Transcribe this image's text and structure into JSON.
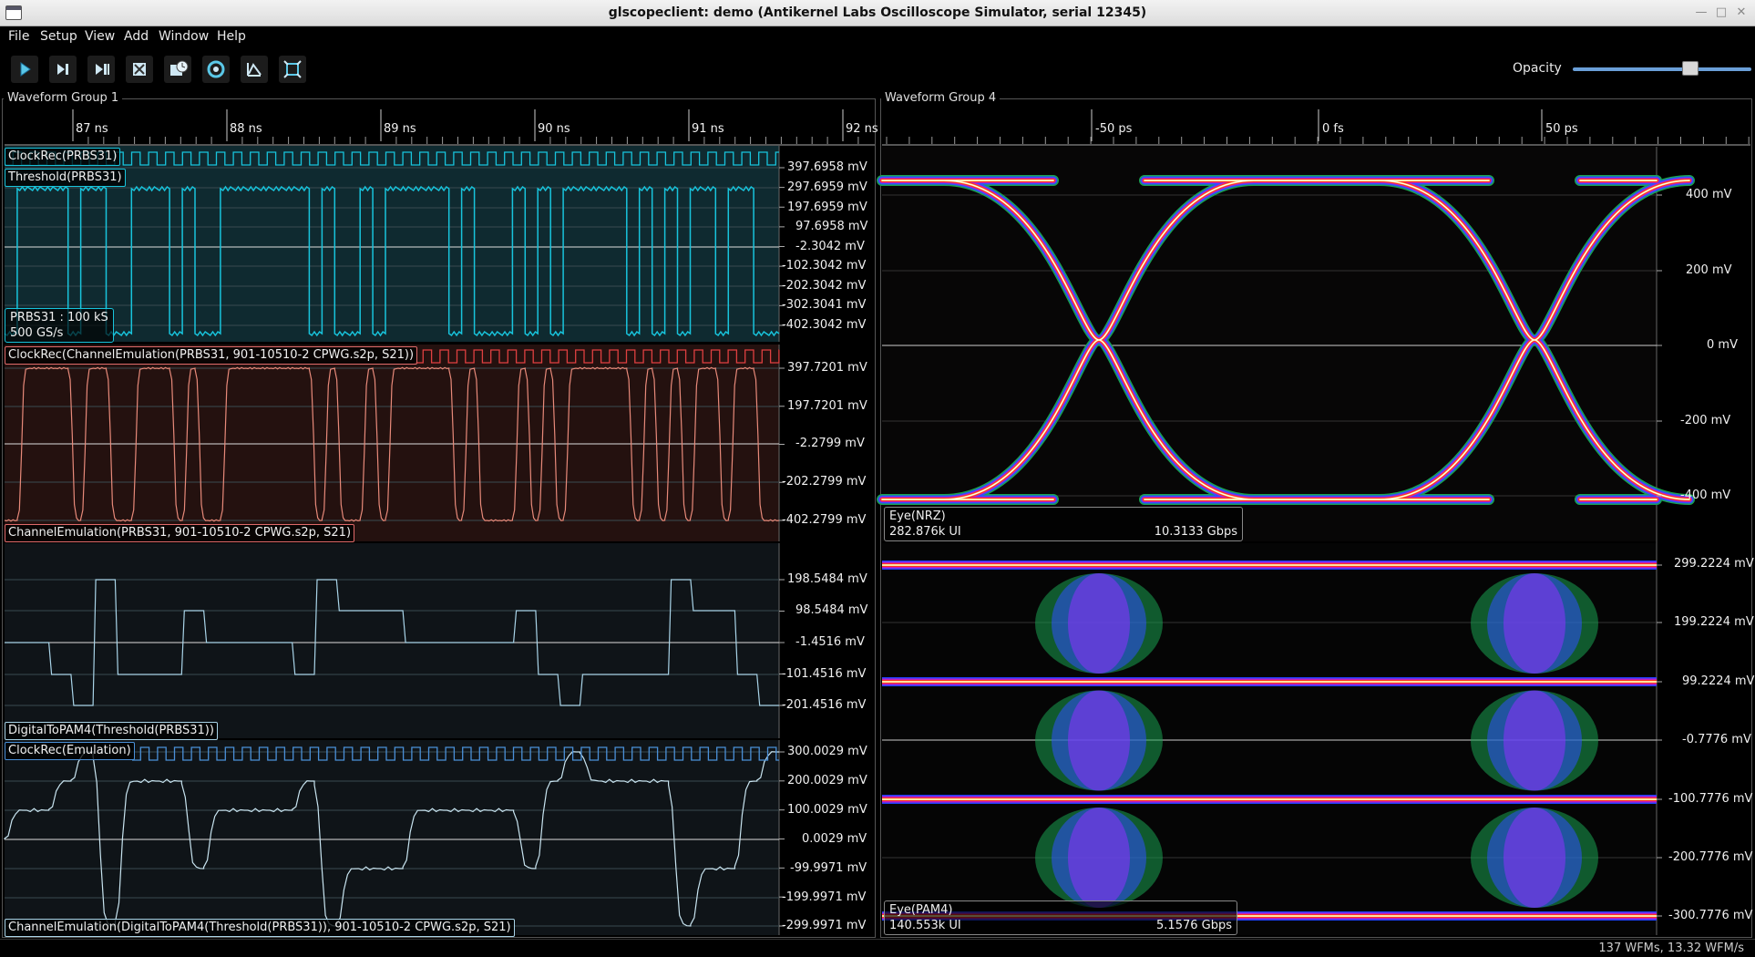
{
  "window": {
    "title": "glscopeclient: demo (Antikernel Labs Oscilloscope Simulator, serial 12345)"
  },
  "menu": [
    "File",
    "Setup",
    "View",
    "Add",
    "Window",
    "Help"
  ],
  "toolbar": {
    "buttons": [
      "start-icon",
      "single-shot-icon",
      "force-trigger-icon",
      "stop-icon",
      "history-icon",
      "refresh-icon",
      "fullscreen-icon",
      "clear-sweeps-icon"
    ],
    "opacity_label": "Opacity",
    "opacity_value": 0.55
  },
  "group1": {
    "title": "Waveform Group 1",
    "time_ticks": [
      "87 ns",
      "88 ns",
      "89 ns",
      "90 ns",
      "91 ns",
      "92 ns"
    ],
    "plots": [
      {
        "color": "#18c4dc",
        "labels": [
          "ClockRec(PRBS31)",
          "Threshold(PRBS31)"
        ],
        "info": [
          "PRBS31 : 100 kS",
          "500 GS/s"
        ],
        "y_ticks": [
          "397.6958 mV",
          "297.6959 mV",
          "197.6959 mV",
          "97.6958 mV",
          "-2.3042 mV",
          "-102.3042 mV",
          "-202.3042 mV",
          "-302.3041 mV",
          "-402.3042 mV"
        ]
      },
      {
        "color": "#e06a6a",
        "labels": [
          "ClockRec(ChannelEmulation(PRBS31, 901-10510-2 CPWG.s2p, S21))"
        ],
        "bottom_label": "ChannelEmulation(PRBS31, 901-10510-2 CPWG.s2p, S21)",
        "y_ticks": [
          "397.7201 mV",
          "197.7201 mV",
          "-2.2799 mV",
          "-202.2799 mV",
          "-402.2799 mV"
        ]
      },
      {
        "color": "#a9d4e8",
        "bottom_label": "DigitalToPAM4(Threshold(PRBS31))",
        "y_ticks": [
          "198.5484 mV",
          "98.5484 mV",
          "-1.4516 mV",
          "-101.4516 mV",
          "-201.4516 mV"
        ]
      },
      {
        "color": "#a9d4e8",
        "labels": [
          "ClockRec(Emulation)"
        ],
        "bottom_label": "ChannelEmulation(DigitalToPAM4(Threshold(PRBS31)), 901-10510-2 CPWG.s2p, S21)",
        "y_ticks": [
          "300.0029 mV",
          "200.0029 mV",
          "100.0029 mV",
          "0.0029 mV",
          "-99.9971 mV",
          "-199.9971 mV",
          "-299.9971 mV"
        ]
      }
    ]
  },
  "group4": {
    "title": "Waveform Group 4",
    "time_ticks": [
      "-50 ps",
      "0 fs",
      "50 ps"
    ],
    "eyes": [
      {
        "name": "Eye(NRZ)",
        "ui": "282.876k UI",
        "rate": "10.3133 Gbps",
        "y_ticks": [
          "400 mV",
          "200 mV",
          "0 mV",
          "-200 mV",
          "-400 mV"
        ]
      },
      {
        "name": "Eye(PAM4)",
        "ui": "140.553k UI",
        "rate": "5.1576 Gbps",
        "y_ticks": [
          "299.2224 mV",
          "199.2224 mV",
          "99.2224 mV",
          "-0.7776 mV",
          "-100.7776 mV",
          "-200.7776 mV",
          "-300.7776 mV"
        ]
      }
    ]
  },
  "status": {
    "text": "137 WFMs, 13.32 WFM/s"
  }
}
